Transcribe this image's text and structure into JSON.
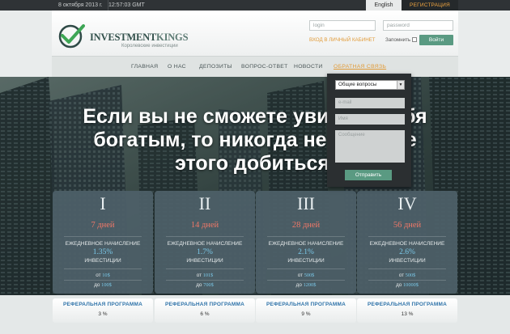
{
  "topbar": {
    "date": "8 октября 2013 г.",
    "time": "12:57:03 GMT",
    "language": "English",
    "register": "РЕГИСТРАЦИЯ"
  },
  "header": {
    "logo_text_a": "INVESTMENT",
    "logo_text_b": "KINGS",
    "logo_subtitle": "Королевские инвестиции",
    "login_placeholder": "login",
    "password_placeholder": "password",
    "cabinet_link": "ВХОД В ЛИЧНЫЙ КАБИНЕТ",
    "remember": "Запомнить",
    "enter_button": "Войти"
  },
  "nav": {
    "items": [
      "ГЛАВНАЯ",
      "О НАС",
      "ДЕПОЗИТЫ",
      "ВОПРОС-ОТВЕТ",
      "НОВОСТИ",
      "ОБРАТНАЯ СВЯЗЬ"
    ]
  },
  "hero": {
    "line1": "Если вы не сможете увидеть себя",
    "line2": "богатым, то никогда не сможете",
    "line3": "этого добиться."
  },
  "contact": {
    "topic_selected": "Общие вопросы",
    "email_placeholder": "e-mail",
    "name_placeholder": "Имя",
    "message_placeholder": "Сообщение",
    "send_button": "Отправить"
  },
  "plans": [
    {
      "roman": "I",
      "days": "7 дней",
      "label_accrual": "ЕЖЕДНЕВНОЕ НАЧИСЛЕНИЕ",
      "percent": "1.35%",
      "label_invest": "ИНВЕСТИЦИИ",
      "from_label": "от",
      "from_value": "10$",
      "to_label": "до",
      "to_value": "100$"
    },
    {
      "roman": "II",
      "days": "14 дней",
      "label_accrual": "ЕЖЕДНЕВНОЕ НАЧИСЛЕНИЕ",
      "percent": "1.7%",
      "label_invest": "ИНВЕСТИЦИИ",
      "from_label": "от",
      "from_value": "101$",
      "to_label": "до",
      "to_value": "700$"
    },
    {
      "roman": "III",
      "days": "28 дней",
      "label_accrual": "ЕЖЕДНЕВНОЕ НАЧИСЛЕНИЕ",
      "percent": "2.1%",
      "label_invest": "ИНВЕСТИЦИИ",
      "from_label": "от",
      "from_value": "500$",
      "to_label": "до",
      "to_value": "1200$"
    },
    {
      "roman": "IV",
      "days": "56 дней",
      "label_accrual": "ЕЖЕДНЕВНОЕ НАЧИСЛЕНИЕ",
      "percent": "2.6%",
      "label_invest": "ИНВЕСТИЦИИ",
      "from_label": "от",
      "from_value": "500$",
      "to_label": "до",
      "to_value": "10000$"
    }
  ],
  "referral": [
    {
      "title": "РЕФЕРАЛЬНАЯ ПРОГРАММА",
      "value": "3 %"
    },
    {
      "title": "РЕФЕРАЛЬНАЯ ПРОГРАММА",
      "value": "6 %"
    },
    {
      "title": "РЕФЕРАЛЬНАЯ ПРОГРАММА",
      "value": "9 %"
    },
    {
      "title": "РЕФЕРАЛЬНАЯ ПРОГРАММА",
      "value": "13 %"
    }
  ],
  "colors": {
    "accent_orange": "#e19b38",
    "button_green": "#5a9a82",
    "days_red": "#f07868",
    "value_blue": "#7ac8e8",
    "referral_blue": "#2f73a9"
  }
}
